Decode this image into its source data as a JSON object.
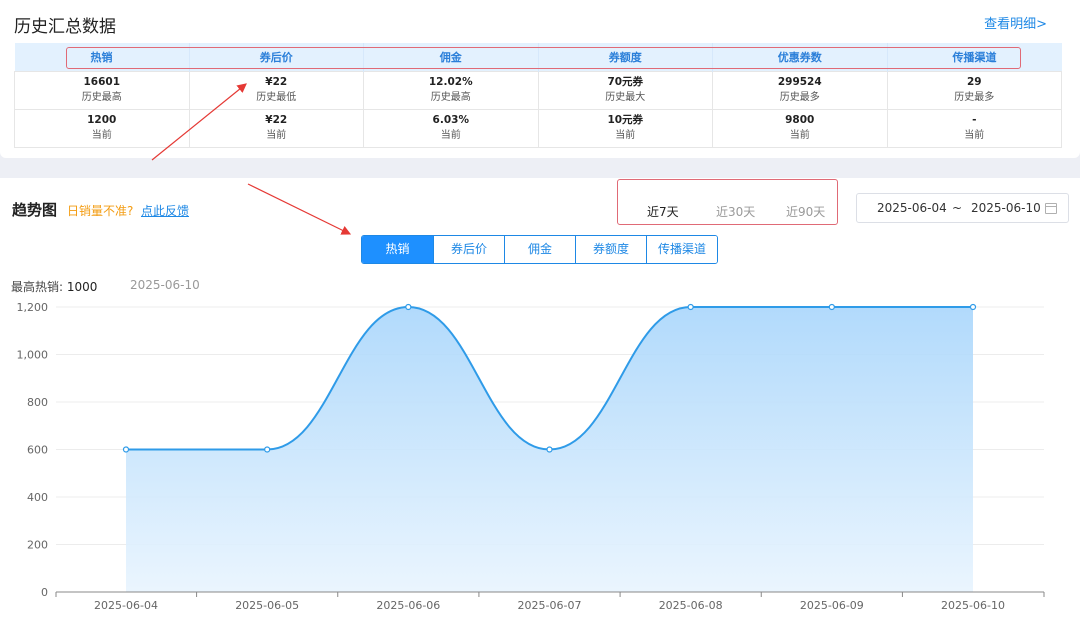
{
  "summary": {
    "title": "历史汇总数据",
    "detail_link": "查看明细>",
    "headers": [
      "热销",
      "券后价",
      "佣金",
      "券额度",
      "优惠券数",
      "传播渠道"
    ],
    "rows": [
      [
        {
          "value": "16601",
          "label": "历史最高"
        },
        {
          "value": "¥22",
          "label": "历史最低"
        },
        {
          "value": "12.02%",
          "label": "历史最高"
        },
        {
          "value": "70元券",
          "label": "历史最大"
        },
        {
          "value": "299524",
          "label": "历史最多"
        },
        {
          "value": "29",
          "label": "历史最多"
        }
      ],
      [
        {
          "value": "1200",
          "label": "当前"
        },
        {
          "value": "¥22",
          "label": "当前"
        },
        {
          "value": "6.03%",
          "label": "当前"
        },
        {
          "value": "10元券",
          "label": "当前"
        },
        {
          "value": "9800",
          "label": "当前"
        },
        {
          "value": "-",
          "label": "当前"
        }
      ]
    ]
  },
  "trend": {
    "title": "趋势图",
    "warn": "日销量不准?",
    "feedback": "点此反馈",
    "ranges": [
      "近7天",
      "近30天",
      "近90天"
    ],
    "active_range": "近7天",
    "date_start": "2025-06-04",
    "date_sep": "~",
    "date_end": "2025-06-10",
    "tabs": [
      "热销",
      "券后价",
      "佣金",
      "券额度",
      "传播渠道"
    ],
    "active_tab": "热销",
    "peak_label": "最高热销:",
    "peak_value": "1000",
    "peak_date": "2025-06-10"
  },
  "colors": {
    "accent": "#1e88e5",
    "highlight_outline": "#e06a76",
    "arrow": "#e53935",
    "line": "#2f9be8"
  },
  "chart_data": {
    "type": "area",
    "x": [
      "2025-06-04",
      "2025-06-05",
      "2025-06-06",
      "2025-06-07",
      "2025-06-08",
      "2025-06-09",
      "2025-06-10"
    ],
    "series": [
      {
        "values": [
          600,
          600,
          1200,
          600,
          1200,
          1200,
          1200
        ]
      }
    ],
    "yticks": [
      "0",
      "200",
      "400",
      "600",
      "800",
      "1,000",
      "1,200"
    ],
    "ylim": [
      0,
      1200
    ],
    "grid": true,
    "smooth": true
  }
}
